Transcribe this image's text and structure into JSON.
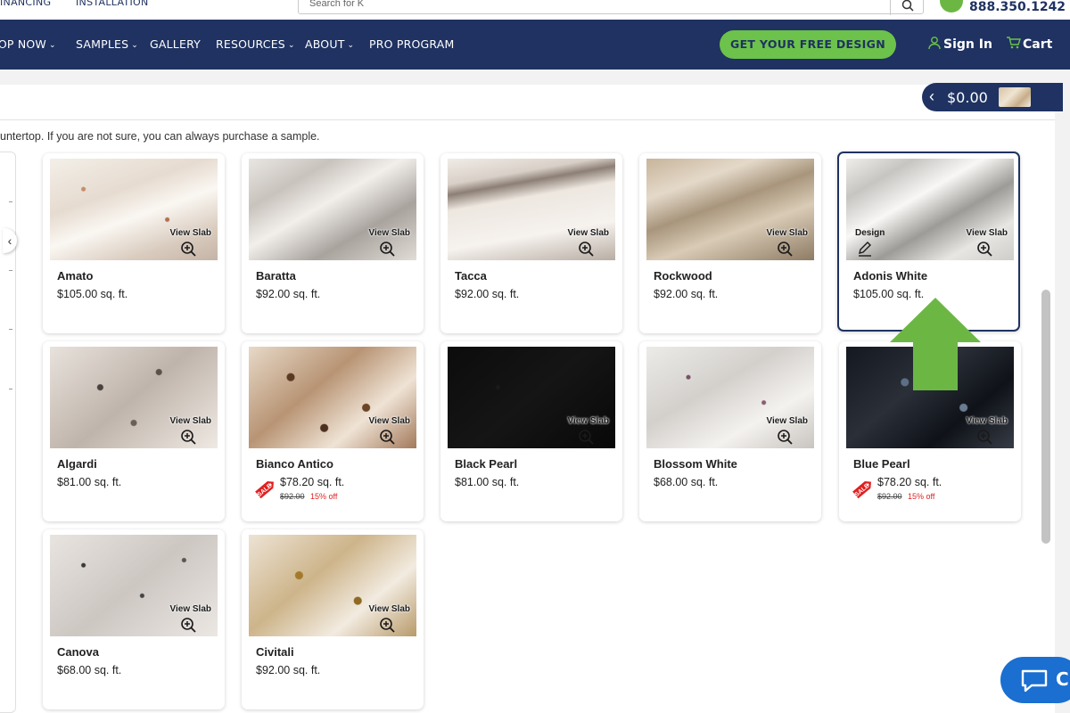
{
  "topbar": {
    "links": [
      "INANCING",
      "INSTALLATION"
    ],
    "search_placeholder": "Search for K",
    "phone": "888.350.1242"
  },
  "nav": {
    "items": [
      {
        "label": "IOP NOW",
        "chevron": true
      },
      {
        "label": "SAMPLES",
        "chevron": true
      },
      {
        "label": "GALLERY",
        "chevron": false
      },
      {
        "label": "RESOURCES",
        "chevron": true
      },
      {
        "label": "ABOUT",
        "chevron": true
      },
      {
        "label": "PRO PROGRAM",
        "chevron": false
      }
    ],
    "cta": "GET YOUR FREE DESIGN",
    "sign_in": "Sign In",
    "cart": "Cart"
  },
  "cart_pill": {
    "amount": "$0.00"
  },
  "helper_text": "untertop. If you are not sure, you can always purchase a sample.",
  "labels": {
    "view_slab": "View Slab",
    "design": "Design"
  },
  "products": [
    {
      "name": "Amato",
      "price": "$105.00 sq. ft.",
      "sale": false
    },
    {
      "name": "Baratta",
      "price": "$92.00 sq. ft.",
      "sale": false
    },
    {
      "name": "Tacca",
      "price": "$92.00 sq. ft.",
      "sale": false
    },
    {
      "name": "Rockwood",
      "price": "$92.00 sq. ft.",
      "sale": false
    },
    {
      "name": "Adonis White",
      "price": "$105.00 sq. ft.",
      "sale": false,
      "selected": true
    },
    {
      "name": "Algardi",
      "price": "$81.00 sq. ft.",
      "sale": false
    },
    {
      "name": "Bianco Antico",
      "price": "$78.20 sq. ft.",
      "sale": true,
      "old_price": "$92.00",
      "discount": "15% off"
    },
    {
      "name": "Black Pearl",
      "price": "$81.00 sq. ft.",
      "sale": false
    },
    {
      "name": "Blossom White",
      "price": "$68.00 sq. ft.",
      "sale": false
    },
    {
      "name": "Blue Pearl",
      "price": "$78.20 sq. ft.",
      "sale": true,
      "old_price": "$92.00",
      "discount": "15% off"
    },
    {
      "name": "Canova",
      "price": "$68.00 sq. ft.",
      "sale": false
    },
    {
      "name": "Civitali",
      "price": "$92.00 sq. ft.",
      "sale": false
    }
  ],
  "sale_tag_text": "SALE",
  "chat": {
    "label": "C"
  },
  "colors": {
    "navy": "#1f3261",
    "green": "#6cc24a",
    "sale_red": "#e02020",
    "chat_blue": "#1a6fd0"
  }
}
